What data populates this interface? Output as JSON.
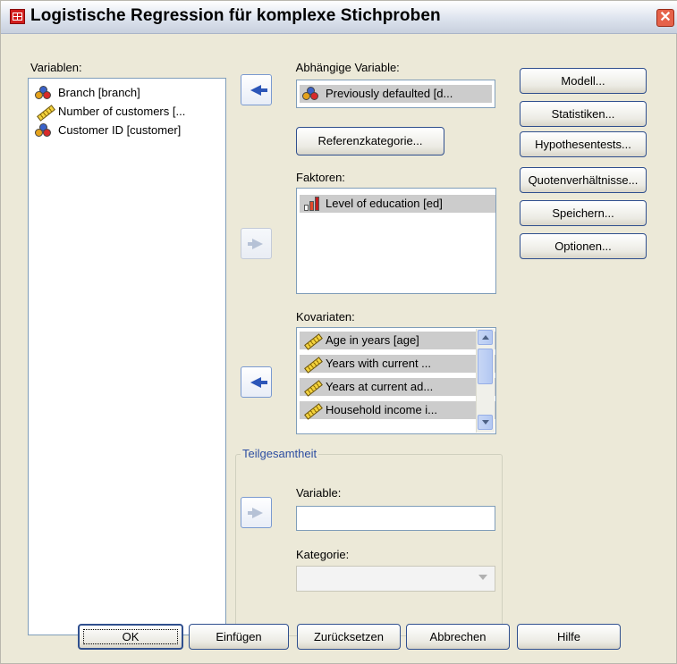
{
  "window": {
    "title": "Logistische Regression für komplexe Stichproben"
  },
  "variables": {
    "label": "Variablen:",
    "items": [
      {
        "label": "Branch [branch]",
        "icon": "nominal-icon"
      },
      {
        "label": "Number of customers [...",
        "icon": "scale-icon"
      },
      {
        "label": "Customer ID [customer]",
        "icon": "nominal-icon"
      }
    ]
  },
  "dependent": {
    "label": "Abhängige Variable:",
    "value": "Previously defaulted [d..."
  },
  "reference_button": "Referenzkategorie...",
  "factors": {
    "label": "Faktoren:",
    "items": [
      {
        "label": "Level of education [ed]",
        "icon": "ordinal-icon"
      }
    ]
  },
  "covariates": {
    "label": "Kovariaten:",
    "items": [
      {
        "label": "Age in years [age]",
        "icon": "scale-icon"
      },
      {
        "label": "Years with current ...",
        "icon": "scale-icon"
      },
      {
        "label": "Years at current ad...",
        "icon": "scale-icon"
      },
      {
        "label": "Household income i...",
        "icon": "scale-icon"
      }
    ]
  },
  "subpopulation": {
    "title": "Teilgesamtheit",
    "variable_label": "Variable:",
    "variable_value": "",
    "category_label": "Kategorie:",
    "category_value": ""
  },
  "side_buttons": {
    "model": "Modell...",
    "statistics": "Statistiken...",
    "hypothesis": "Hypothesentests...",
    "odds": "Quotenverhältnisse...",
    "save": "Speichern...",
    "options": "Optionen..."
  },
  "bottom_buttons": {
    "ok": "OK",
    "paste": "Einfügen",
    "reset": "Zurücksetzen",
    "cancel": "Abbrechen",
    "help": "Hilfe"
  },
  "colors": {
    "accent": "#2f4f8e",
    "group_title": "#2d4ea1",
    "selection": "#cccccc"
  }
}
